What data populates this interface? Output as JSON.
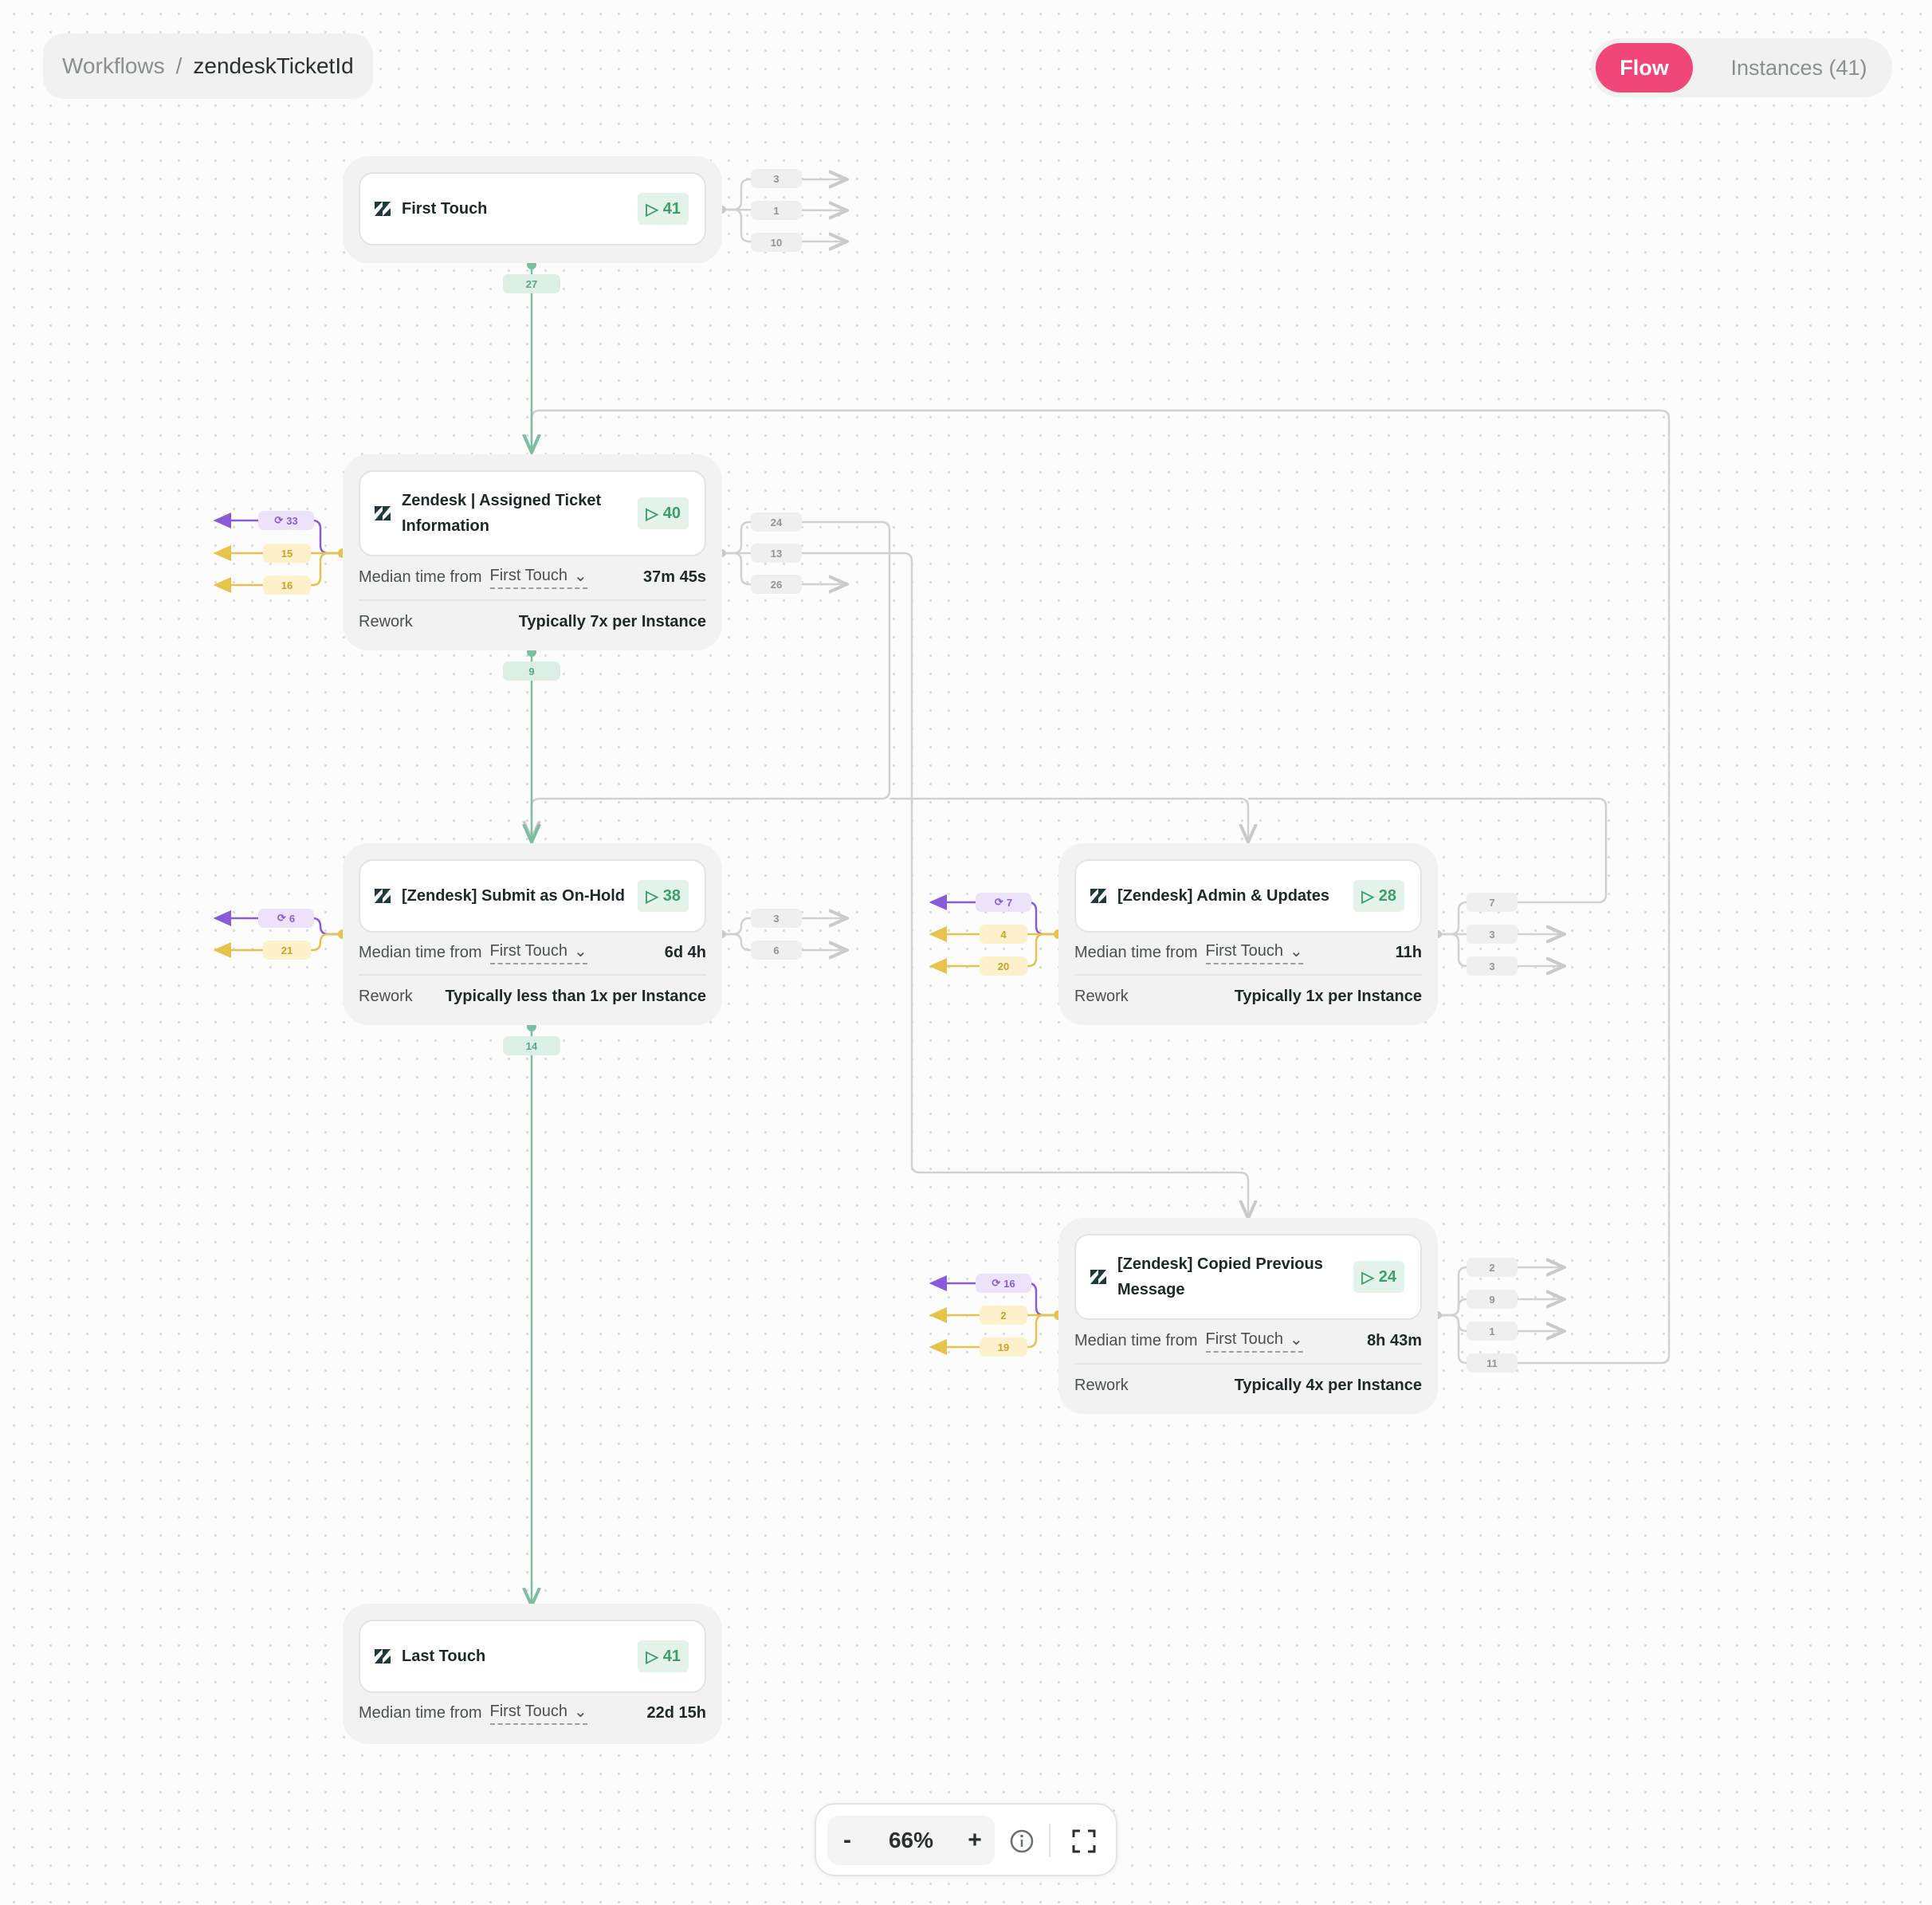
{
  "breadcrumb": {
    "root": "Workflows",
    "separator": "/",
    "current": "zendeskTicketId"
  },
  "view_toggle": {
    "flow_label": "Flow",
    "instances_label": "Instances (41)",
    "active": "Flow"
  },
  "nodes": {
    "first_touch": {
      "title": "First Touch",
      "count": "41",
      "icon": "zendesk-icon",
      "outgoing": [
        "3",
        "1",
        "10"
      ],
      "forward": "27"
    },
    "assigned_ticket": {
      "title_line1": "Zendesk | Assigned Ticket",
      "title_line2": "Information",
      "count": "40",
      "median_label": "Median time from",
      "median_ref": "First Touch",
      "median_value": "37m 45s",
      "rework_label": "Rework",
      "rework_value": "Typically 7x per Instance",
      "incoming_rework": "33",
      "incoming": [
        "15",
        "16"
      ],
      "outgoing": [
        "24",
        "13",
        "26"
      ],
      "forward": "9"
    },
    "on_hold": {
      "title": "[Zendesk] Submit as On-Hold",
      "count": "38",
      "median_label": "Median time from",
      "median_ref": "First Touch",
      "median_value": "6d 4h",
      "rework_label": "Rework",
      "rework_value": "Typically less than 1x per Instance",
      "incoming_rework": "6",
      "incoming": [
        "21"
      ],
      "outgoing": [
        "3",
        "6"
      ],
      "forward": "14"
    },
    "admin_updates": {
      "title": "[Zendesk] Admin & Updates",
      "count": "28",
      "median_label": "Median time from",
      "median_ref": "First Touch",
      "median_value": "11h",
      "rework_label": "Rework",
      "rework_value": "Typically 1x per Instance",
      "incoming_rework": "7",
      "incoming": [
        "4",
        "20"
      ],
      "outgoing": [
        "7",
        "3",
        "3"
      ]
    },
    "copied_message": {
      "title_line1": "[Zendesk] Copied Previous",
      "title_line2": "Message",
      "count": "24",
      "median_label": "Median time from",
      "median_ref": "First Touch",
      "median_value": "8h 43m",
      "rework_label": "Rework",
      "rework_value": "Typically 4x per Instance",
      "incoming_rework": "16",
      "incoming": [
        "2",
        "19"
      ],
      "outgoing": [
        "2",
        "9",
        "1",
        "11"
      ]
    },
    "last_touch": {
      "title": "Last Touch",
      "count": "41",
      "median_label": "Median time from",
      "median_ref": "First Touch",
      "median_value": "22d 15h"
    }
  },
  "zoom": {
    "minus": "-",
    "level": "66%",
    "plus": "+"
  },
  "colors": {
    "accent": "#f0467a",
    "flow_green": "#7bbfa0",
    "rework_purple": "#8a5bd8",
    "incoming_yellow": "#e6c34a",
    "edge_gray": "#d0d2d2"
  }
}
